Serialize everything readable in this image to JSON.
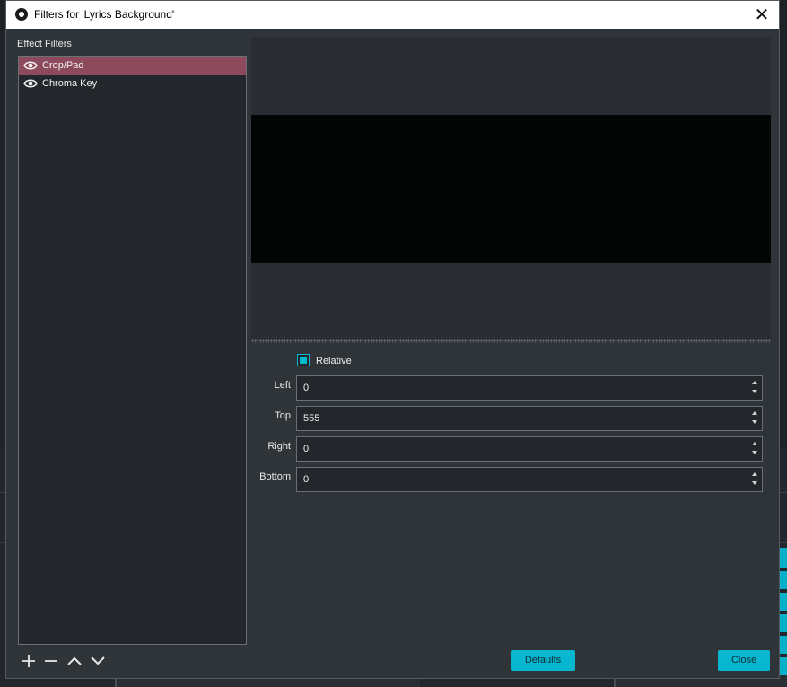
{
  "window": {
    "title": "Filters for 'Lyrics Background'",
    "close_glyph": "✕"
  },
  "effect_filters": {
    "heading": "Effect Filters",
    "items": [
      {
        "label": "Crop/Pad",
        "icon": "eye-icon",
        "selected": true
      },
      {
        "label": "Chroma Key",
        "icon": "eye-icon",
        "selected": false
      }
    ]
  },
  "toolbar": {
    "add_icon": "plus-icon",
    "remove_icon": "minus-icon",
    "move_up_icon": "chevron-up-icon",
    "move_down_icon": "chevron-down-icon"
  },
  "properties": {
    "relative_label": "Relative",
    "relative_checked": true,
    "fields": [
      {
        "label": "Left",
        "value": "0"
      },
      {
        "label": "Top",
        "value": "555"
      },
      {
        "label": "Right",
        "value": "0"
      },
      {
        "label": "Bottom",
        "value": "0"
      }
    ]
  },
  "buttons": {
    "defaults": "Defaults",
    "close": "Close"
  },
  "colors": {
    "accent": "#06b7cf",
    "selection": "#8d4a5d",
    "dialog_bg": "#2f3439"
  }
}
